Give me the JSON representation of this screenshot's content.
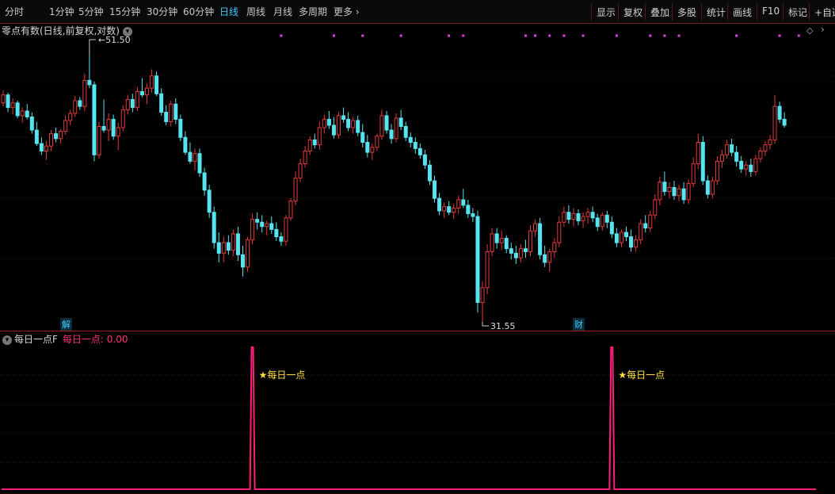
{
  "toolbar": {
    "periods": [
      "分时",
      "1分钟",
      "5分钟",
      "15分钟",
      "30分钟",
      "60分钟",
      "日线",
      "周线",
      "月线",
      "多周期",
      "更多"
    ],
    "active_period": "日线",
    "more_chevron": "›",
    "right_buttons": [
      "显示",
      "复权",
      "叠加",
      "多股",
      "统计",
      "画线",
      "F10",
      "标记",
      "+自选"
    ]
  },
  "main_chart": {
    "title": "零点有数(日线,前复权,对数)",
    "high_label": "51.50",
    "low_label": "31.55",
    "badge_jie": "解",
    "badge_cai": "财",
    "colors": {
      "up": "#e23a3a",
      "down": "#54e5f0",
      "grid": "#5a1212",
      "marker": "#e040e0"
    }
  },
  "sub_chart": {
    "indicator_name": "每日一点F",
    "value_label": "每日一点: 0.00",
    "signal_text": "★每日一点",
    "colors": {
      "line": "#ff1f7a",
      "signal": "#ffe33b"
    }
  },
  "chart_data": [
    {
      "type": "candlestick",
      "title": "",
      "scale": "log",
      "ylim": [
        31.55,
        51.5
      ],
      "max_label": 51.5,
      "min_label": 31.55,
      "candles_note": "",
      "ohlc": [
        [
          47.2,
          48.3,
          46.9,
          47.9
        ],
        [
          47.9,
          48.1,
          46.4,
          46.8
        ],
        [
          46.8,
          47.6,
          46.2,
          47.2
        ],
        [
          47.2,
          47.4,
          45.9,
          46.1
        ],
        [
          46.1,
          46.8,
          45.5,
          46.5
        ],
        [
          46.5,
          47.1,
          45.8,
          46.0
        ],
        [
          46.0,
          46.4,
          44.6,
          44.9
        ],
        [
          44.9,
          45.6,
          43.6,
          43.8
        ],
        [
          43.8,
          44.3,
          42.9,
          43.2
        ],
        [
          43.2,
          44.0,
          42.5,
          43.6
        ],
        [
          43.6,
          44.9,
          43.2,
          44.6
        ],
        [
          44.6,
          45.1,
          43.9,
          44.2
        ],
        [
          44.2,
          45.0,
          43.8,
          44.8
        ],
        [
          44.8,
          46.1,
          44.5,
          45.7
        ],
        [
          45.7,
          46.6,
          45.3,
          46.3
        ],
        [
          46.3,
          47.8,
          46.0,
          47.4
        ],
        [
          47.4,
          47.7,
          46.6,
          46.9
        ],
        [
          46.9,
          49.8,
          46.5,
          49.2
        ],
        [
          49.2,
          51.5,
          48.5,
          48.8
        ],
        [
          48.8,
          49.1,
          42.4,
          42.9
        ],
        [
          42.9,
          45.6,
          42.6,
          45.2
        ],
        [
          45.2,
          47.5,
          44.7,
          44.9
        ],
        [
          44.9,
          46.3,
          44.0,
          45.8
        ],
        [
          45.8,
          46.2,
          44.1,
          44.4
        ],
        [
          44.4,
          45.5,
          43.3,
          45.1
        ],
        [
          45.1,
          47.0,
          44.8,
          46.6
        ],
        [
          46.6,
          47.9,
          46.2,
          47.5
        ],
        [
          47.5,
          48.0,
          46.4,
          46.8
        ],
        [
          46.8,
          48.6,
          46.5,
          48.2
        ],
        [
          48.2,
          49.4,
          47.7,
          47.9
        ],
        [
          47.9,
          48.9,
          47.1,
          48.5
        ],
        [
          48.5,
          50.2,
          48.1,
          49.6
        ],
        [
          49.6,
          50.0,
          47.8,
          48.0
        ],
        [
          48.0,
          48.5,
          46.1,
          46.4
        ],
        [
          46.4,
          47.0,
          45.3,
          45.6
        ],
        [
          45.6,
          47.4,
          45.2,
          47.1
        ],
        [
          47.1,
          47.6,
          45.4,
          45.8
        ],
        [
          45.8,
          46.2,
          44.0,
          44.3
        ],
        [
          44.3,
          44.8,
          42.9,
          43.1
        ],
        [
          43.1,
          43.9,
          42.2,
          42.4
        ],
        [
          42.4,
          43.4,
          41.7,
          43.0
        ],
        [
          43.0,
          43.4,
          41.2,
          41.5
        ],
        [
          41.5,
          41.9,
          39.8,
          40.2
        ],
        [
          40.2,
          40.6,
          38.2,
          38.6
        ],
        [
          38.6,
          39.0,
          36.1,
          36.5
        ],
        [
          36.5,
          37.2,
          35.2,
          35.8
        ],
        [
          35.8,
          36.9,
          35.2,
          36.5
        ],
        [
          36.5,
          37.0,
          35.7,
          36.0
        ],
        [
          36.0,
          37.4,
          35.6,
          37.1
        ],
        [
          37.1,
          37.6,
          35.3,
          35.7
        ],
        [
          35.7,
          36.3,
          34.3,
          34.9
        ],
        [
          34.9,
          36.9,
          34.6,
          36.7
        ],
        [
          36.7,
          38.5,
          36.4,
          38.1
        ],
        [
          38.1,
          38.6,
          37.4,
          37.9
        ],
        [
          37.9,
          38.4,
          37.2,
          37.6
        ],
        [
          37.6,
          38.0,
          37.0,
          37.8
        ],
        [
          37.8,
          38.3,
          37.1,
          37.4
        ],
        [
          37.4,
          37.9,
          36.6,
          36.9
        ],
        [
          36.9,
          37.2,
          36.3,
          36.6
        ],
        [
          36.6,
          38.4,
          36.3,
          38.2
        ],
        [
          38.2,
          39.6,
          38.0,
          39.4
        ],
        [
          39.4,
          41.6,
          39.1,
          41.1
        ],
        [
          41.1,
          42.6,
          40.8,
          42.2
        ],
        [
          42.2,
          43.6,
          41.9,
          43.2
        ],
        [
          43.2,
          44.4,
          42.9,
          44.1
        ],
        [
          44.1,
          44.6,
          43.4,
          43.7
        ],
        [
          43.7,
          45.6,
          43.3,
          45.1
        ],
        [
          45.1,
          46.2,
          44.6,
          45.8
        ],
        [
          45.8,
          46.5,
          45.0,
          45.3
        ],
        [
          45.3,
          46.0,
          44.2,
          44.5
        ],
        [
          44.5,
          46.4,
          44.2,
          46.1
        ],
        [
          46.1,
          46.8,
          45.5,
          45.8
        ],
        [
          45.8,
          46.4,
          44.8,
          45.1
        ],
        [
          45.1,
          46.0,
          44.6,
          45.7
        ],
        [
          45.7,
          46.1,
          44.4,
          44.7
        ],
        [
          44.7,
          45.4,
          43.5,
          43.9
        ],
        [
          43.9,
          44.5,
          42.7,
          43.1
        ],
        [
          43.1,
          43.8,
          42.5,
          43.5
        ],
        [
          43.5,
          44.6,
          43.2,
          44.4
        ],
        [
          44.4,
          46.6,
          44.1,
          46.1
        ],
        [
          46.1,
          46.5,
          44.6,
          44.9
        ],
        [
          44.9,
          45.4,
          43.8,
          44.2
        ],
        [
          44.2,
          46.3,
          43.9,
          45.9
        ],
        [
          45.9,
          46.6,
          44.9,
          45.2
        ],
        [
          45.2,
          45.6,
          44.0,
          44.3
        ],
        [
          44.3,
          44.7,
          43.5,
          43.9
        ],
        [
          43.9,
          44.3,
          43.0,
          43.4
        ],
        [
          43.4,
          43.8,
          42.6,
          42.9
        ],
        [
          42.9,
          43.3,
          41.8,
          42.1
        ],
        [
          42.1,
          42.5,
          40.6,
          40.9
        ],
        [
          40.9,
          41.3,
          39.3,
          39.6
        ],
        [
          39.6,
          40.0,
          38.4,
          38.7
        ],
        [
          38.7,
          39.3,
          38.2,
          39.0
        ],
        [
          39.0,
          39.4,
          38.4,
          38.6
        ],
        [
          38.6,
          39.2,
          38.1,
          38.9
        ],
        [
          38.9,
          39.8,
          38.5,
          39.5
        ],
        [
          39.5,
          40.3,
          38.9,
          39.1
        ],
        [
          39.1,
          39.5,
          38.2,
          38.5
        ],
        [
          38.5,
          38.9,
          37.9,
          38.3
        ],
        [
          38.3,
          38.7,
          32.1,
          32.7
        ],
        [
          32.7,
          34.0,
          31.55,
          33.6
        ],
        [
          33.6,
          36.4,
          33.2,
          35.9
        ],
        [
          35.9,
          37.5,
          35.6,
          37.1
        ],
        [
          37.1,
          37.5,
          36.1,
          36.5
        ],
        [
          36.5,
          37.3,
          36.0,
          36.8
        ],
        [
          36.8,
          37.0,
          35.8,
          36.1
        ],
        [
          36.1,
          36.5,
          35.4,
          35.8
        ],
        [
          35.8,
          36.3,
          35.1,
          35.5
        ],
        [
          35.5,
          36.4,
          35.2,
          36.1
        ],
        [
          36.1,
          36.7,
          35.5,
          35.9
        ],
        [
          35.9,
          37.7,
          35.6,
          37.3
        ],
        [
          37.3,
          38.1,
          36.9,
          37.8
        ],
        [
          37.8,
          38.2,
          35.4,
          35.7
        ],
        [
          35.7,
          36.3,
          34.9,
          35.2
        ],
        [
          35.2,
          36.1,
          34.6,
          35.9
        ],
        [
          35.9,
          36.8,
          35.5,
          36.5
        ],
        [
          36.5,
          38.3,
          36.2,
          37.9
        ],
        [
          37.9,
          39.0,
          37.6,
          38.6
        ],
        [
          38.6,
          39.1,
          37.8,
          38.1
        ],
        [
          38.1,
          38.9,
          37.6,
          38.5
        ],
        [
          38.5,
          38.8,
          37.7,
          38.0
        ],
        [
          38.0,
          38.6,
          37.5,
          38.3
        ],
        [
          38.3,
          38.9,
          37.8,
          38.6
        ],
        [
          38.6,
          39.0,
          37.9,
          38.2
        ],
        [
          38.2,
          38.5,
          37.3,
          37.6
        ],
        [
          37.6,
          38.6,
          37.3,
          38.4
        ],
        [
          38.4,
          38.7,
          37.5,
          37.9
        ],
        [
          37.9,
          38.3,
          36.8,
          37.1
        ],
        [
          37.1,
          37.5,
          36.2,
          36.5
        ],
        [
          36.5,
          37.4,
          36.2,
          37.2
        ],
        [
          37.2,
          37.6,
          36.6,
          36.9
        ],
        [
          36.9,
          37.4,
          35.9,
          36.2
        ],
        [
          36.2,
          37.0,
          35.9,
          36.7
        ],
        [
          36.7,
          38.1,
          36.4,
          37.8
        ],
        [
          37.8,
          38.4,
          37.2,
          37.5
        ],
        [
          37.5,
          38.7,
          37.2,
          38.4
        ],
        [
          38.4,
          39.9,
          38.1,
          39.5
        ],
        [
          39.5,
          41.2,
          39.1,
          40.8
        ],
        [
          40.8,
          41.6,
          39.8,
          40.1
        ],
        [
          40.1,
          40.8,
          39.6,
          40.4
        ],
        [
          40.4,
          40.9,
          39.5,
          39.8
        ],
        [
          39.8,
          40.6,
          39.4,
          40.3
        ],
        [
          40.3,
          40.8,
          39.2,
          39.5
        ],
        [
          39.5,
          41.0,
          39.2,
          40.7
        ],
        [
          40.7,
          42.7,
          40.4,
          42.2
        ],
        [
          42.2,
          44.6,
          41.8,
          43.9
        ],
        [
          43.9,
          44.4,
          40.6,
          40.9
        ],
        [
          40.9,
          41.3,
          39.6,
          39.9
        ],
        [
          39.9,
          41.2,
          39.6,
          40.9
        ],
        [
          40.9,
          42.8,
          40.6,
          42.4
        ],
        [
          42.4,
          43.3,
          41.9,
          42.9
        ],
        [
          42.9,
          44.1,
          42.6,
          43.7
        ],
        [
          43.7,
          44.2,
          42.8,
          43.1
        ],
        [
          43.1,
          43.6,
          42.0,
          42.4
        ],
        [
          42.4,
          42.8,
          41.5,
          41.8
        ],
        [
          41.8,
          42.4,
          41.3,
          42.1
        ],
        [
          42.1,
          42.6,
          41.2,
          41.6
        ],
        [
          41.6,
          42.9,
          41.3,
          42.6
        ],
        [
          42.6,
          43.5,
          42.3,
          43.2
        ],
        [
          43.2,
          44.0,
          42.8,
          43.7
        ],
        [
          43.7,
          44.5,
          43.3,
          44.1
        ],
        [
          44.1,
          47.9,
          43.8,
          46.9
        ],
        [
          46.9,
          47.3,
          45.5,
          45.8
        ],
        [
          45.8,
          46.4,
          45.1,
          45.3
        ]
      ],
      "top_markers": [
        58,
        69,
        75,
        83,
        93,
        96,
        109,
        111,
        114,
        117,
        121,
        128,
        135,
        138,
        141,
        153,
        162,
        166
      ]
    },
    {
      "type": "line",
      "title": "",
      "series": [
        {
          "name": "每日一点",
          "value": 0.0,
          "spikes_at_candle": [
            52,
            127
          ]
        }
      ],
      "ylim": [
        0,
        1
      ]
    }
  ]
}
